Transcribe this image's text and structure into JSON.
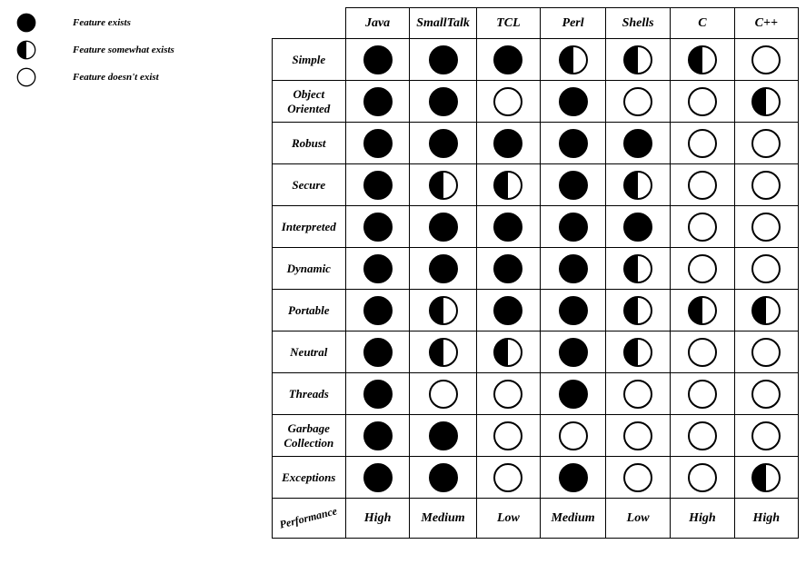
{
  "legend": [
    {
      "icon": "full",
      "label": "Feature exists"
    },
    {
      "icon": "half",
      "label": "Feature somewhat exists"
    },
    {
      "icon": "empty",
      "label": "Feature doesn't exist"
    }
  ],
  "chart_data": {
    "type": "table",
    "languages": [
      "Java",
      "SmallTalk",
      "TCL",
      "Perl",
      "Shells",
      "C",
      "C++"
    ],
    "features": [
      "Simple",
      "Object Oriented",
      "Robust",
      "Secure",
      "Interpreted",
      "Dynamic",
      "Portable",
      "Neutral",
      "Threads",
      "Garbage Collection",
      "Exceptions"
    ],
    "values": [
      [
        "full",
        "full",
        "full",
        "half",
        "half",
        "half",
        "empty"
      ],
      [
        "full",
        "full",
        "empty",
        "full",
        "empty",
        "empty",
        "half"
      ],
      [
        "full",
        "full",
        "full",
        "full",
        "full",
        "empty",
        "empty"
      ],
      [
        "full",
        "half",
        "half",
        "full",
        "half",
        "empty",
        "empty"
      ],
      [
        "full",
        "full",
        "full",
        "full",
        "full",
        "empty",
        "empty"
      ],
      [
        "full",
        "full",
        "full",
        "full",
        "half",
        "empty",
        "empty"
      ],
      [
        "full",
        "half",
        "full",
        "full",
        "half",
        "half",
        "half"
      ],
      [
        "full",
        "half",
        "half",
        "full",
        "half",
        "empty",
        "empty"
      ],
      [
        "full",
        "empty",
        "empty",
        "full",
        "empty",
        "empty",
        "empty"
      ],
      [
        "full",
        "full",
        "empty",
        "empty",
        "empty",
        "empty",
        "empty"
      ],
      [
        "full",
        "full",
        "empty",
        "full",
        "empty",
        "empty",
        "half"
      ]
    ],
    "performance_label": "Performance",
    "performance": [
      "High",
      "Medium",
      "Low",
      "Medium",
      "Low",
      "High",
      "High"
    ]
  }
}
